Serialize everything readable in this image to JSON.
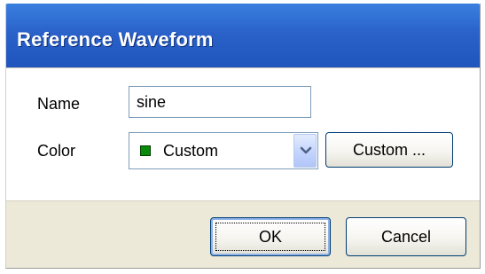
{
  "window": {
    "title": "Reference Waveform"
  },
  "form": {
    "name_label": "Name",
    "name_value": "sine",
    "color_label": "Color",
    "color_selected": "Custom",
    "color_swatch": "#0a8a0a",
    "custom_button_label": "Custom ..."
  },
  "footer": {
    "ok_label": "OK",
    "cancel_label": "Cancel"
  },
  "icons": {
    "dropdown": "chevron-down-icon"
  },
  "colors": {
    "titlebar": "#2a62c9",
    "dialog_bg": "#ece9d8",
    "field_border": "#7f9db9"
  }
}
